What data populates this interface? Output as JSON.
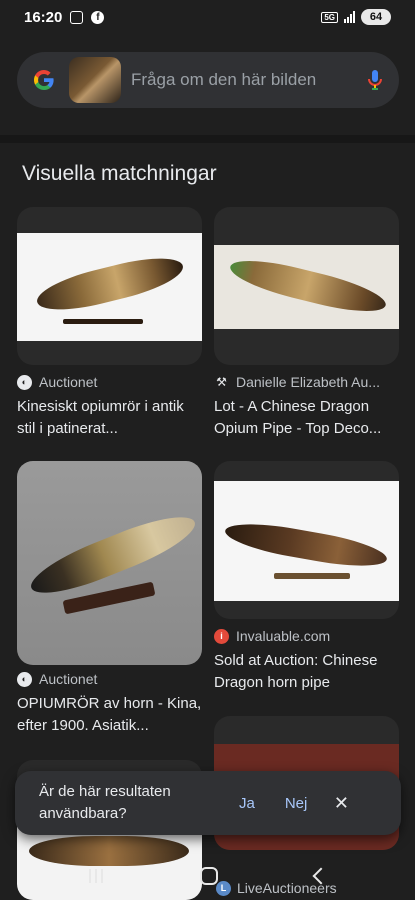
{
  "status_bar": {
    "time": "16:20",
    "network_badge": "5G",
    "battery": "64"
  },
  "search": {
    "placeholder": "Fråga om den här bilden"
  },
  "section_title": "Visuella matchningar",
  "results": [
    {
      "source": "Auctionet",
      "source_icon": "auctionet-icon",
      "title": "Kinesiskt opiumrör i antik stil i patinerat..."
    },
    {
      "source": "Danielle Elizabeth Au...",
      "source_icon": "danielle-elizabeth-icon",
      "title": "Lot - A Chinese Dragon Opium Pipe - Top Deco..."
    },
    {
      "source": "Auctionet",
      "source_icon": "auctionet-icon",
      "title": "OPIUMRÖR av horn - Kina, efter 1900. Asiatik..."
    },
    {
      "source": "Invaluable.com",
      "source_icon": "invaluable-icon",
      "title": "Sold at Auction: Chinese Dragon horn pipe"
    }
  ],
  "bottom_source": "LiveAuctioneers",
  "feedback": {
    "question": "Är de här resultaten användbara?",
    "yes": "Ja",
    "no": "Nej"
  },
  "icons": [
    "google-logo-icon",
    "mic-icon",
    "close-icon",
    "home-icon",
    "back-icon",
    "recents-icon"
  ]
}
